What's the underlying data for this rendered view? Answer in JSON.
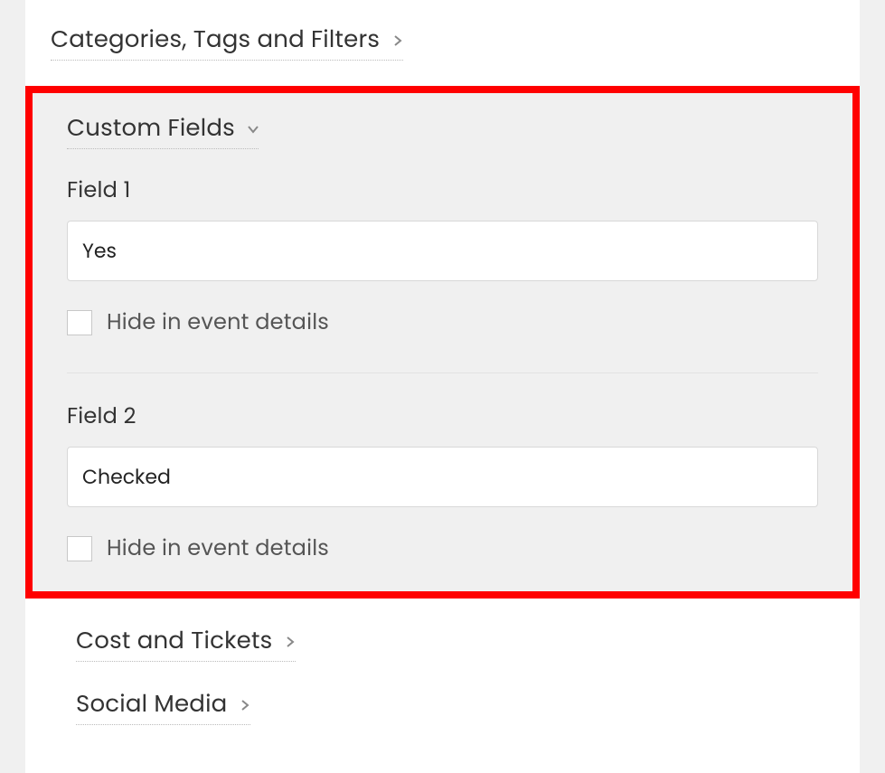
{
  "sections": {
    "categories": {
      "label": "Categories, Tags and Filters"
    },
    "custom_fields": {
      "label": "Custom Fields"
    },
    "cost_tickets": {
      "label": "Cost and Tickets"
    },
    "social_media": {
      "label": "Social Media"
    }
  },
  "custom_fields": {
    "field1": {
      "label": "Field 1",
      "value": "Yes",
      "hide_label": "Hide in event details"
    },
    "field2": {
      "label": "Field 2",
      "value": "Checked",
      "hide_label": "Hide in event details"
    }
  }
}
